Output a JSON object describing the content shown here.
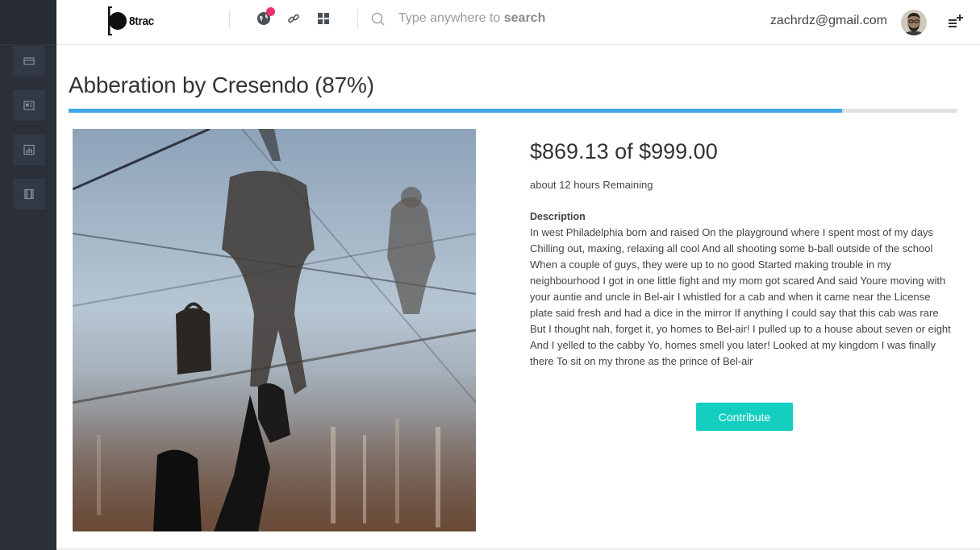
{
  "app": {
    "logo_text": "8trac"
  },
  "search": {
    "hint_prefix": "Type anywhere to",
    "hint_keyword": "search"
  },
  "user": {
    "email": "zachrdz@gmail.com"
  },
  "sidebar": {
    "items": [
      {
        "icon": "card-icon"
      },
      {
        "icon": "newspaper-icon"
      },
      {
        "icon": "bar-chart-icon"
      },
      {
        "icon": "book-icon"
      }
    ]
  },
  "topbar": {
    "icons": [
      "globe-icon",
      "link-icon",
      "grid-icon"
    ],
    "notification_color": "#e8336e"
  },
  "campaign": {
    "title": "Abberation by Cresendo (87%)",
    "progress_fraction": 0.87,
    "amount_text": "$869.13 of $999.00",
    "remaining_text": "about 12 hours Remaining",
    "description_label": "Description",
    "description_lines": [
      "In west Philadelphia born and raised On the playground where I spent most of my days",
      "Chilling out, maxing, relaxing all cool And all shooting some b-ball outside of the school",
      "When a couple of guys, they were up to no good Started making trouble in my",
      "neighbourhood I got in one little fight and my mom got scared And said Youre moving with",
      "your auntie and uncle in Bel-air I whistled for a cab and when it came near the License",
      "plate said fresh and had a dice in the mirror If anything I could say that this cab was rare",
      "But I thought nah, forget it, yo homes to Bel-air! I pulled up to a house about seven or eight",
      "And I yelled to the cabby Yo, homes smell you later! Looked at my kingdom I was finally",
      "there To sit on my throne as the prince of Bel-air"
    ],
    "contribute_label": "Contribute"
  },
  "colors": {
    "accent": "#41a8e8",
    "button": "#14cfc0",
    "sidebar": "#2a2f3a"
  }
}
